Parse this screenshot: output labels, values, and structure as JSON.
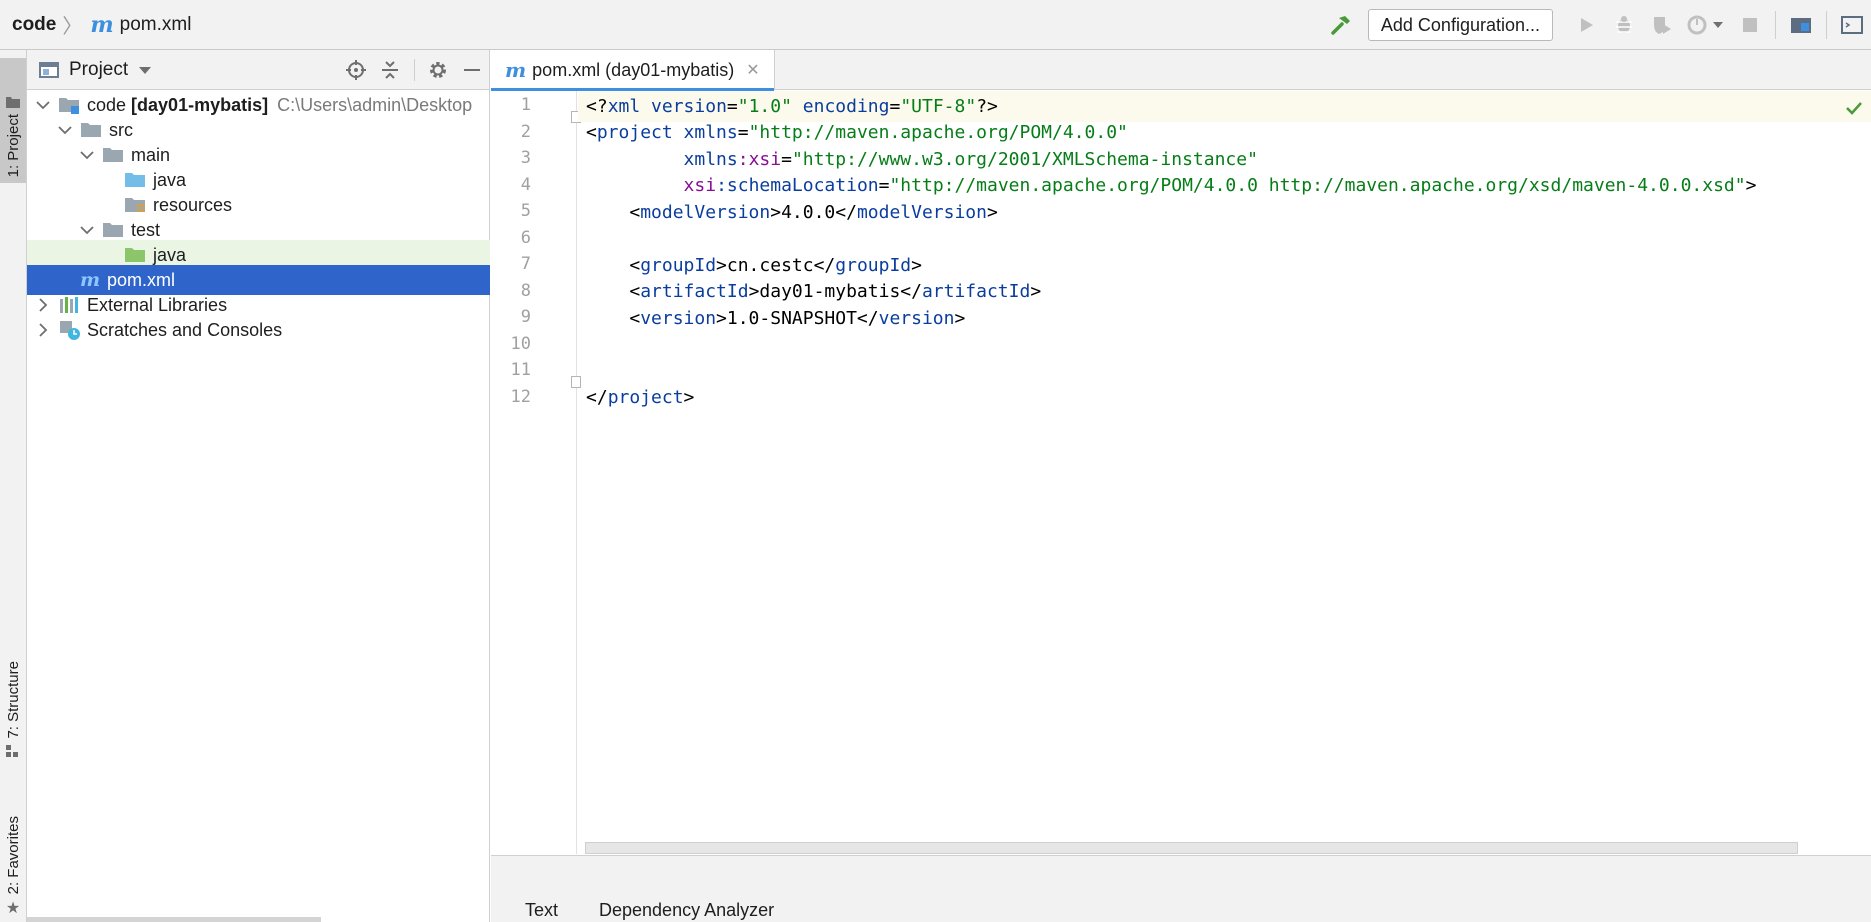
{
  "navbar": {
    "breadcrumb_root": "code",
    "breadcrumb_file": "pom.xml",
    "add_configuration": "Add Configuration..."
  },
  "stripe": {
    "project": "1: Project",
    "structure": "7: Structure",
    "favorites": "2: Favorites"
  },
  "project_panel": {
    "title": "Project",
    "tree": [
      {
        "label": "code",
        "bold": "[day01-mybatis]",
        "path": "C:\\Users\\admin\\Desktop"
      },
      {
        "label": "src"
      },
      {
        "label": "main"
      },
      {
        "label": "java"
      },
      {
        "label": "resources"
      },
      {
        "label": "test"
      },
      {
        "label": "java"
      },
      {
        "label": "pom.xml"
      },
      {
        "label": "External Libraries"
      },
      {
        "label": "Scratches and Consoles"
      }
    ]
  },
  "editor": {
    "tab_label": "pom.xml (day01-mybatis)",
    "line_numbers": [
      "1",
      "2",
      "3",
      "4",
      "5",
      "6",
      "7",
      "8",
      "9",
      "10",
      "11",
      "12"
    ],
    "bottom_tabs": [
      "Text",
      "Dependency Analyzer"
    ]
  },
  "colors": {
    "accent": "#3d8fe0",
    "selection": "#2f65ca",
    "xml_tag": "#0a3d9e",
    "xml_value": "#067d17",
    "xml_namespace": "#871094"
  }
}
